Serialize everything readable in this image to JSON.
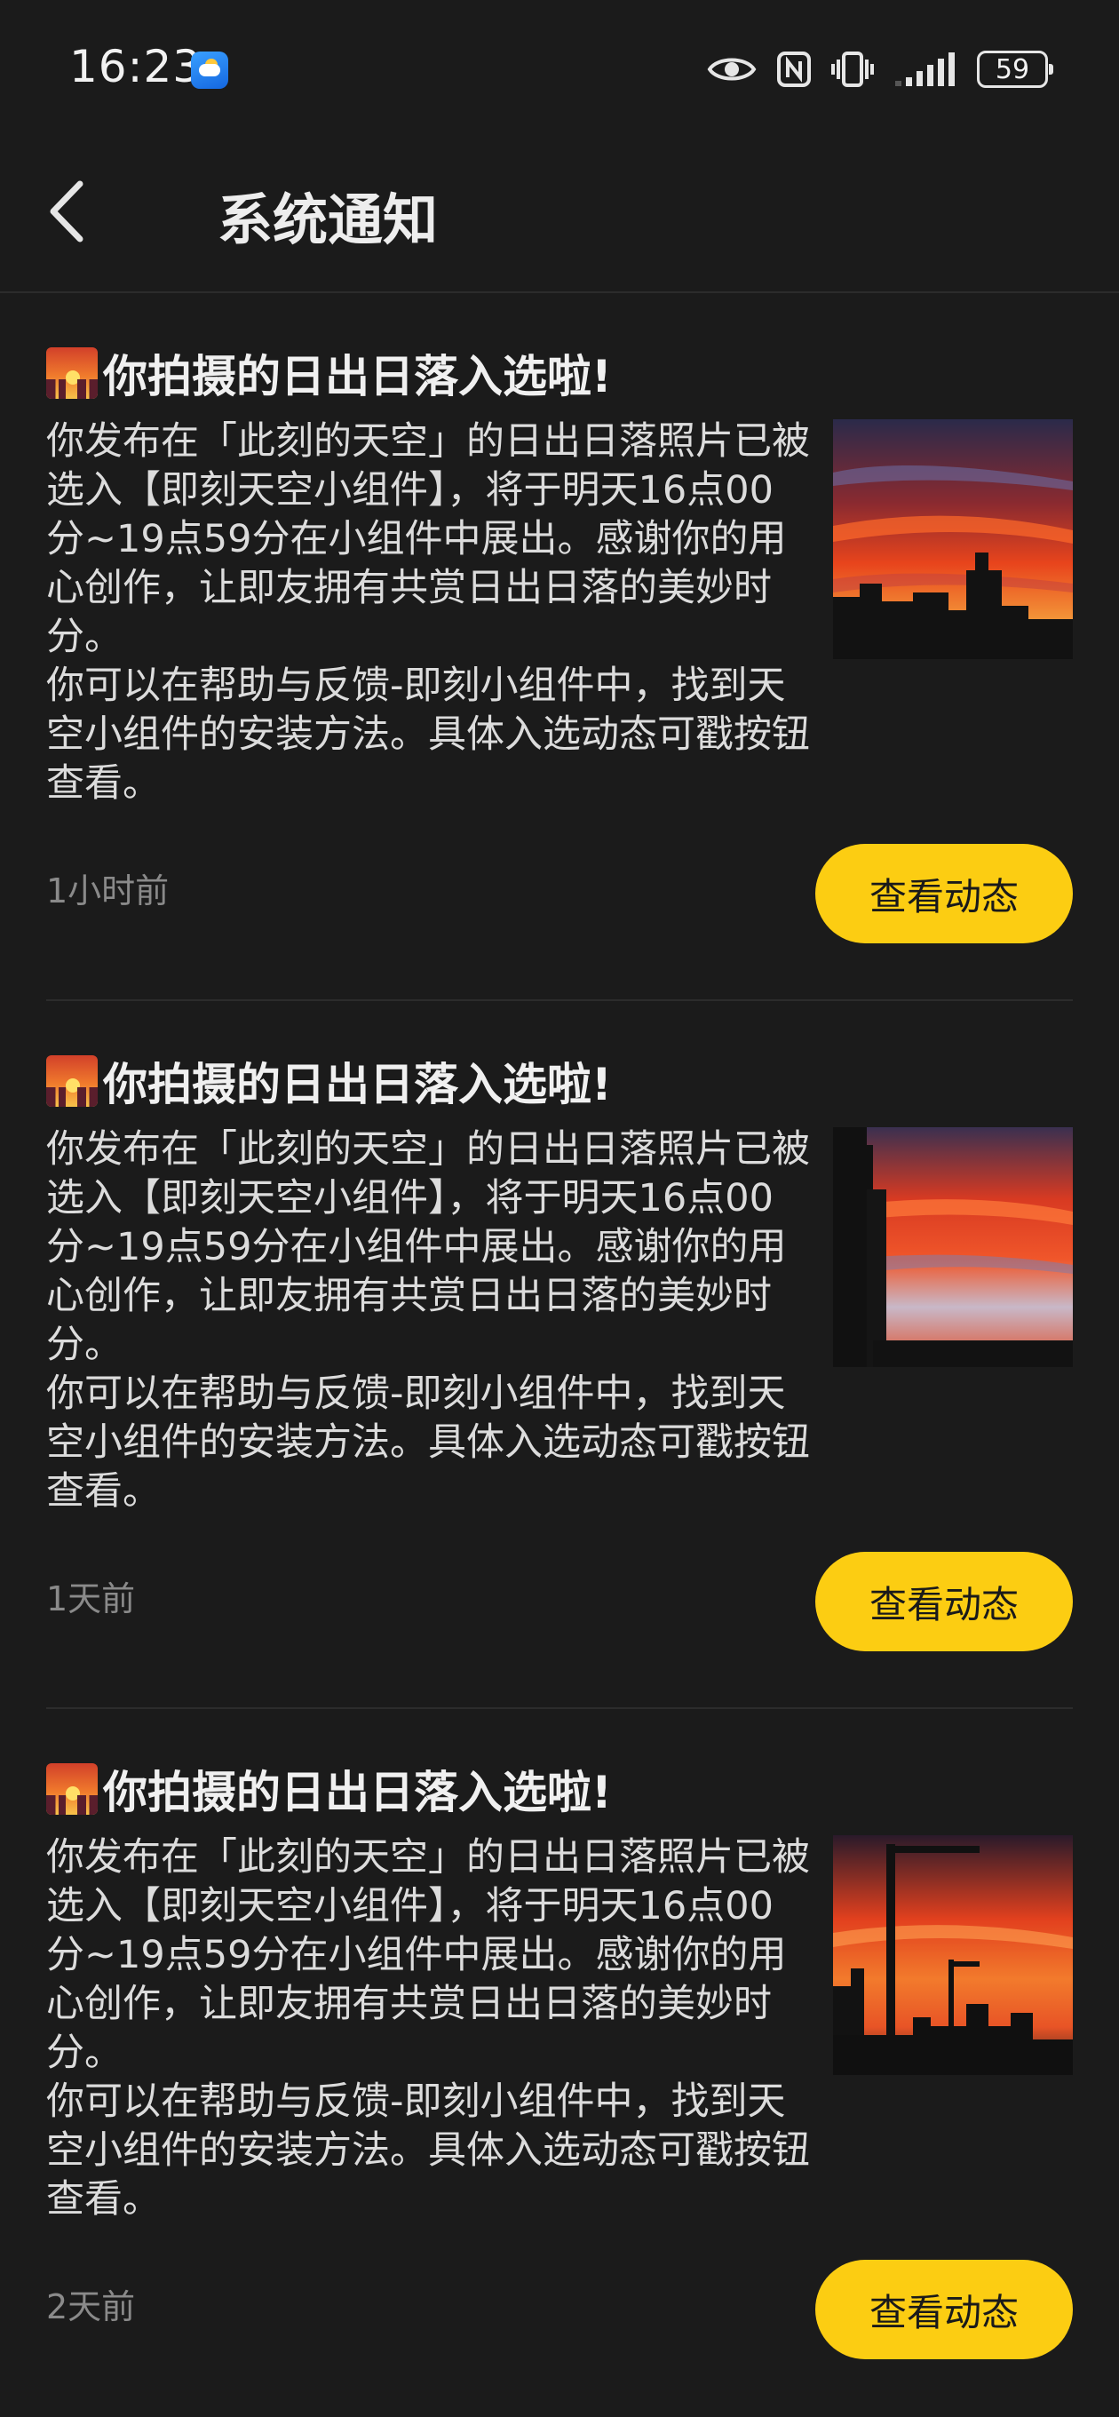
{
  "status_bar": {
    "time": "16:23",
    "weather_icon": "weather-cloud-sun-icon",
    "icons": [
      "eye-comfort-icon",
      "nfc-icon",
      "vibrate-icon",
      "cellular-signal-icon"
    ],
    "battery": "59"
  },
  "header": {
    "back_icon": "chevron-left-icon",
    "title": "系统通知"
  },
  "notifications": [
    {
      "emoji": "sunset-emoji",
      "title": "你拍摄的日出日落入选啦!",
      "body_p1": "你发布在「此刻的天空」的日出日落照片已被选入【即刻天空小组件】，将于明天16点00分~19点59分在小组件中展出。感谢你的用心创作，让即友拥有共赏日出日落的美妙时分。",
      "body_p2": "你可以在帮助与反馈-即刻小组件中，找到天空小组件的安装方法。具体入选动态可戳按钮查看。",
      "time": "1小时前",
      "button_label": "查看动态"
    },
    {
      "emoji": "sunset-emoji",
      "title": "你拍摄的日出日落入选啦!",
      "body_p1": "你发布在「此刻的天空」的日出日落照片已被选入【即刻天空小组件】，将于明天16点00分~19点59分在小组件中展出。感谢你的用心创作，让即友拥有共赏日出日落的美妙时分。",
      "body_p2": "你可以在帮助与反馈-即刻小组件中，找到天空小组件的安装方法。具体入选动态可戳按钮查看。",
      "time": "1天前",
      "button_label": "查看动态"
    },
    {
      "emoji": "sunset-emoji",
      "title": "你拍摄的日出日落入选啦!",
      "body_p1": "你发布在「此刻的天空」的日出日落照片已被选入【即刻天空小组件】，将于明天16点00分~19点59分在小组件中展出。感谢你的用心创作，让即友拥有共赏日出日落的美妙时分。",
      "body_p2": "你可以在帮助与反馈-即刻小组件中，找到天空小组件的安装方法。具体入选动态可戳按钮查看。",
      "time": "2天前",
      "button_label": "查看动态"
    }
  ],
  "colors": {
    "background": "#1b1b1b",
    "accent_button": "#fccd12",
    "divider": "#2c2c2c",
    "muted_text": "#8a8a8a"
  }
}
